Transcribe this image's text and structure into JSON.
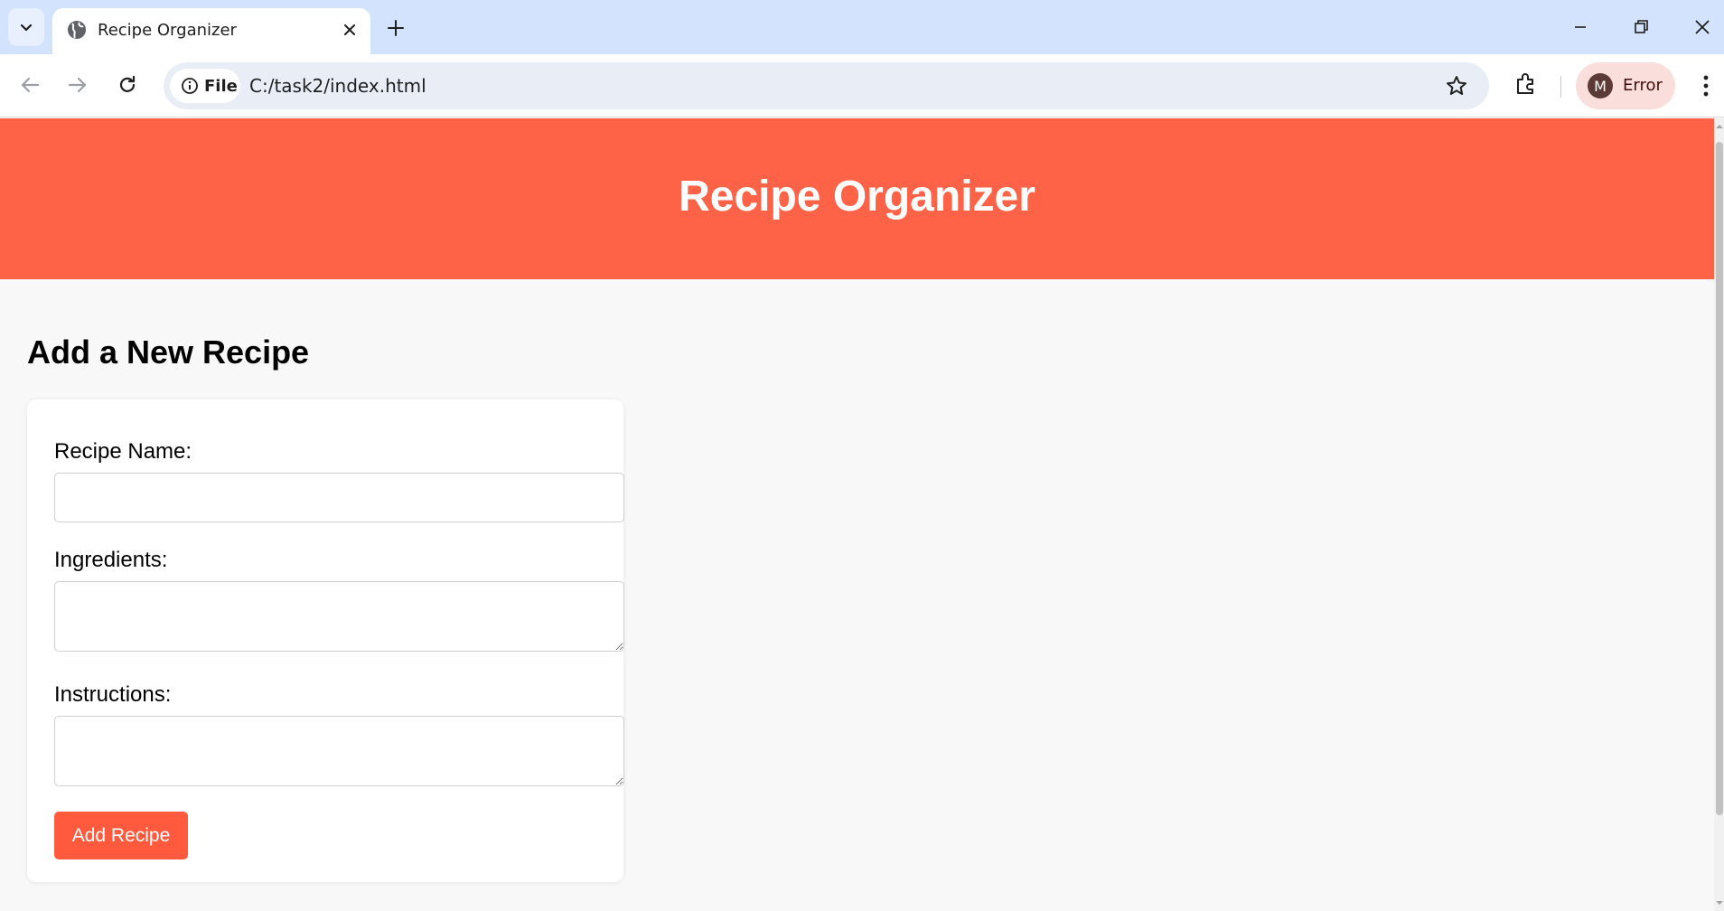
{
  "browser": {
    "tab_title": "Recipe Organizer",
    "address_chip": "File",
    "url": "C:/task2/index.html",
    "profile_initial": "M",
    "profile_label": "Error",
    "icons": [
      "chevron-down-icon",
      "globe-icon",
      "close-icon",
      "plus-icon",
      "minimize-icon",
      "restore-icon",
      "window-close-icon",
      "back-arrow-icon",
      "forward-arrow-icon",
      "reload-icon",
      "info-icon",
      "star-icon",
      "extensions-icon",
      "kebab-menu-icon"
    ]
  },
  "page": {
    "header_title": "Recipe Organizer",
    "section_title": "Add a New Recipe",
    "form": {
      "name_label": "Recipe Name:",
      "name_value": "",
      "ingredients_label": "Ingredients:",
      "ingredients_value": "",
      "instructions_label": "Instructions:",
      "instructions_value": "",
      "submit_label": "Add Recipe"
    }
  },
  "colors": {
    "header_bg": "#ff6347",
    "button_bg": "#ff5a3d",
    "page_bg": "#f8f8f8",
    "tabstrip_bg": "#d3e3fd"
  }
}
